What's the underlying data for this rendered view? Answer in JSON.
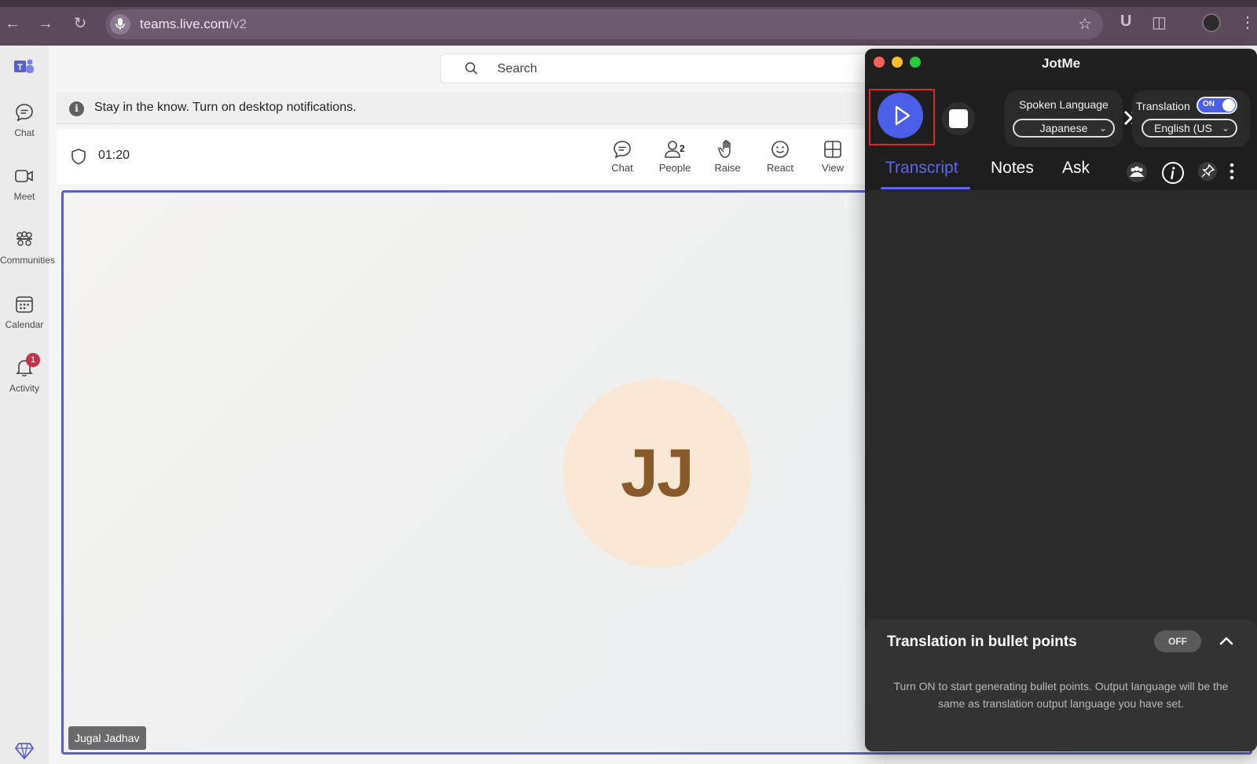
{
  "browser": {
    "url_host": "teams.live.com",
    "url_path": "/v2"
  },
  "rail": {
    "items": [
      {
        "label": "Chat",
        "icon": "chat-icon"
      },
      {
        "label": "Meet",
        "icon": "video-icon"
      },
      {
        "label": "Communities",
        "icon": "communities-icon"
      },
      {
        "label": "Calendar",
        "icon": "calendar-icon"
      },
      {
        "label": "Activity",
        "icon": "bell-icon",
        "badge": "1"
      }
    ]
  },
  "search": {
    "placeholder": "Search"
  },
  "notice": {
    "text": "Stay in the know. Turn on desktop notifications."
  },
  "meeting": {
    "timer": "01:20",
    "toolbar": [
      {
        "label": "Chat",
        "icon": "chat-icon"
      },
      {
        "label": "People",
        "icon": "people-icon",
        "count": "2"
      },
      {
        "label": "Raise",
        "icon": "hand-icon"
      },
      {
        "label": "React",
        "icon": "smiley-icon"
      },
      {
        "label": "View",
        "icon": "grid-icon"
      }
    ],
    "participant_initials": "JJ",
    "participant_name": "Jugal Jadhav"
  },
  "jotme": {
    "title": "JotMe",
    "spoken_language_label": "Spoken Language",
    "spoken_language_value": "Japanese",
    "translation_label": "Translation",
    "translation_toggle": "ON",
    "translation_language": "English (US",
    "tabs": [
      "Transcript",
      "Notes",
      "Ask"
    ],
    "active_tab": "Transcript",
    "bullet_title": "Translation in bullet points",
    "bullet_toggle": "OFF",
    "bullet_desc": "Turn ON to start generating bullet points. Output language will be the same as translation output language you have set.",
    "colors": {
      "accent": "#4a5ee8",
      "highlight": "#e0242a",
      "teams": "#5b5fc7"
    }
  }
}
